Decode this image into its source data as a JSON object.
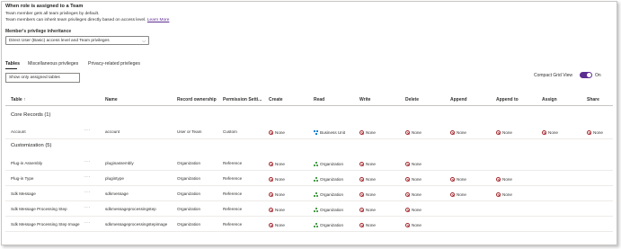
{
  "header": {
    "title": "When role is assigned to a Team",
    "line1": "Team member gets all team privileges by default.",
    "line2": "Team members can inherit team privileges directly based on access level.",
    "learn_more": "Learn More",
    "inherit_label": "Member's privilege inheritance",
    "inherit_value": "Direct User (Basic) access level and Team privileges"
  },
  "tabs": [
    {
      "label": "Tables",
      "active": true
    },
    {
      "label": "Miscellaneous privileges",
      "active": false
    },
    {
      "label": "Privacy-related privileges",
      "active": false
    }
  ],
  "search": {
    "placeholder": "Show only assigned tables"
  },
  "compact": {
    "label": "Compact Grid View",
    "state": "On",
    "on": true
  },
  "columns": [
    "Table ↑",
    "Name",
    "Record ownership",
    "Permission Setti...",
    "Create",
    "Read",
    "Write",
    "Delete",
    "Append",
    "Append to",
    "Assign",
    "Share"
  ],
  "groups": [
    {
      "label": "Core Records (1)"
    },
    {
      "label": "Customization (5)"
    }
  ],
  "rows": [
    {
      "table": "Account",
      "more": "···",
      "name": "account",
      "ownership": "User or Team",
      "permission": "Custom",
      "p": [
        [
          "None",
          "none"
        ],
        [
          "Business Unit",
          "bu"
        ],
        [
          "None",
          "none"
        ],
        [
          "None",
          "none"
        ],
        [
          "None",
          "none"
        ],
        [
          "None",
          "none"
        ],
        [
          "None",
          "none"
        ],
        [
          "None",
          "none"
        ]
      ]
    },
    {
      "table": "Plug-in Assembly",
      "more": "···",
      "name": "pluginassembly",
      "ownership": "Organization",
      "permission": "Reference",
      "p": [
        [
          "None",
          "none"
        ],
        [
          "Organization",
          "org"
        ],
        [
          "None",
          "none"
        ],
        [
          "None",
          "none"
        ]
      ]
    },
    {
      "table": "Plug-in Type",
      "more": "···",
      "name": "plugintype",
      "ownership": "Organization",
      "permission": "Reference",
      "p": [
        [
          "None",
          "none"
        ],
        [
          "Organization",
          "org"
        ],
        [
          "None",
          "none"
        ],
        [
          "None",
          "none"
        ],
        [
          "None",
          "none"
        ],
        [
          "None",
          "none"
        ]
      ]
    },
    {
      "table": "Sdk Message",
      "more": "···",
      "name": "sdkmessage",
      "ownership": "Organization",
      "permission": "Reference",
      "p": [
        [
          "None",
          "none"
        ],
        [
          "Organization",
          "org"
        ],
        [
          "None",
          "none"
        ],
        [
          "None",
          "none"
        ],
        [
          "None",
          "none"
        ],
        [
          "None",
          "none"
        ]
      ]
    },
    {
      "table": "Sdk Message Processing Step",
      "more": "···",
      "name": "sdkmessageprocessingstep",
      "ownership": "Organization",
      "permission": "Reference",
      "p": [
        [
          "None",
          "none"
        ],
        [
          "Organization",
          "org"
        ],
        [
          "None",
          "none"
        ],
        [
          "None",
          "none"
        ]
      ]
    },
    {
      "table": "Sdk Message Processing Step Image",
      "more": "···",
      "name": "sdkmessageprocessingstepimage",
      "ownership": "Organization",
      "permission": "Reference",
      "p": [
        [
          "None",
          "none"
        ],
        [
          "Organization",
          "org"
        ],
        [
          "None",
          "none"
        ],
        [
          "None",
          "none"
        ]
      ]
    }
  ],
  "colors": {
    "accent": "#5c2d91",
    "none": "#a4262c",
    "org": "#107c10",
    "bu": "#0078d4"
  }
}
